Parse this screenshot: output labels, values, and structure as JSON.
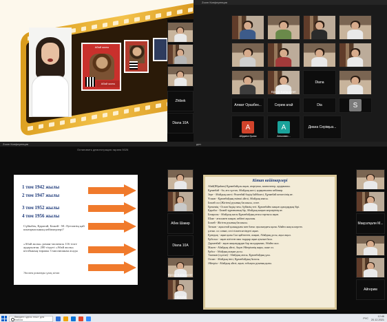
{
  "quadrant1": {
    "window_title": "",
    "frame_top_text": "Абай жолы",
    "frame_caption": "Абай жолы",
    "participants": [
      {
        "name": "Zhibek"
      },
      {
        "name": "Diana 10A"
      }
    ]
  },
  "quadrant2": {
    "window_title": "Zoom Конференция",
    "participants": [
      {
        "name": ""
      },
      {
        "name": ""
      },
      {
        "name": ""
      },
      {
        "name": ""
      },
      {
        "name": ""
      },
      {
        "name": ""
      },
      {
        "name": ""
      },
      {
        "name": ""
      },
      {
        "name": ""
      },
      {
        "name": "Ерсұр Байдаулет"
      },
      {
        "name": "Diana"
      },
      {
        "name": ""
      },
      {
        "name": "Алмат Оразбек..."
      },
      {
        "name": "Сериж агай"
      },
      {
        "name": "Dia"
      },
      {
        "name": "S"
      },
      {
        "name": "Айдана Қызы"
      },
      {
        "name": "Альсамо..."
      },
      {
        "name": "Диана Серікқыз..."
      }
    ],
    "avatars": [
      {
        "letter": "S",
        "color": "#7a7a7a"
      },
      {
        "letter": "A",
        "color": "#d1432b"
      },
      {
        "letter": "A",
        "color": "#1aa39b"
      }
    ]
  },
  "quadrant3": {
    "window_title": "Zoom Конференция",
    "conference_label": "Остановить демонстрацию экрана 5026",
    "slide": {
      "lines": [
        "1 том 1942 жылы",
        "2 том 1947 жылы",
        "3 том 1952 жылы",
        "4 том 1956 жылы"
      ],
      "question": "Сүйінбек, Қаратай, Бөжей - М. Әуезовтің қай шығармасының кейіпкерлері?",
      "quote": "«Абай жолы» роман-эпопеясы 116 тілге аударылған. 200 тілдегі «Абай жолы» кітабының тиражы 3 миллионнан асады",
      "footer": "Эпопея романды ұзақ кітап"
    },
    "participants": [
      {
        "name": "Айгерім"
      },
      {
        "name": "Абек Шакир"
      },
      {
        "name": "Diana 10A"
      },
      {
        "name": "Ерсұр Байдаулет"
      }
    ]
  },
  "quadrant4": {
    "window_title": "ден",
    "doc": {
      "heading": "Кітап кейіпкерлері",
      "lines": [
        "Абай(Ибраһим) Құнанбайұлы ақын, ағартушы, композитор, аудармашы.",
        "Құнанбай - би, аға сұлтан, Абайдың әкесі, қорқынышты кейіпкер.",
        "Зере - Абайдың әжесі. Өскенбай бидің бәйбішесі, Құнанбай шешесінің ие.",
        "Ұлжан - Құнанбайдың екінші әйелі, Абайдың анасы.",
        "Бөжей сол (Жігітек) руының басшысы, сөзге.",
        "Ерекемің - Оспан бидің тағы, бүйіктің тегі. Құнанбайға жақын адамдардың бірі.",
        "Қарабас - Бөжей тұрғанының бір, Абайдың жақын жерлерінің ие.",
        "Базаралы - Абайдың жасы Құнанбайдың ағасы тартысы ақын.",
        "Шәке - ағасымен жақын, кейінгі ақылшы.",
        "Божей - Жігітек руының басшысы.",
        "Тоғжан - ақжолтай қалыңдығы мен батыс ауылындағы қызы Абайға жақсы көрген.",
        "ұлтып. ол сонын, сөзі тілмен кезіндегі ақын.",
        "Қуандық - ақын қызы Сыз қайтпеген, жақын, Абайдың досы, ақыл ақыл.",
        "Ерболыс - ақын жігітген наш тырдыр ақын ауызын бала.",
        "Дәрменбай - ақын жақындардан бар жолдарынан, Абайға жол.",
        "Мәкен - Абайдың әйелі, Ақын Әйгерімнің жары, шәке ол.",
        "Ербол - Абайдың жақын досы.",
        "Тәкежан (сұлтан) - Абайдың ағасы, Құнанбайдың ұлы.",
        "Оспан - Абайдың інісі, Құнанбайдың баласы.",
        "Әйгерім - Абайдың әйелі, ақын, тобықты руының қызы."
      ]
    },
    "participants": [
      {
        "name": ""
      },
      {
        "name": ""
      },
      {
        "name": "Мақсатқали М..."
      },
      {
        "name": "Айгерим"
      }
    ]
  },
  "taskbar": {
    "search_placeholder": "Введите здесь текст для поиска",
    "lang": "РУС",
    "time": "12:46",
    "date": "20.12.2021"
  }
}
